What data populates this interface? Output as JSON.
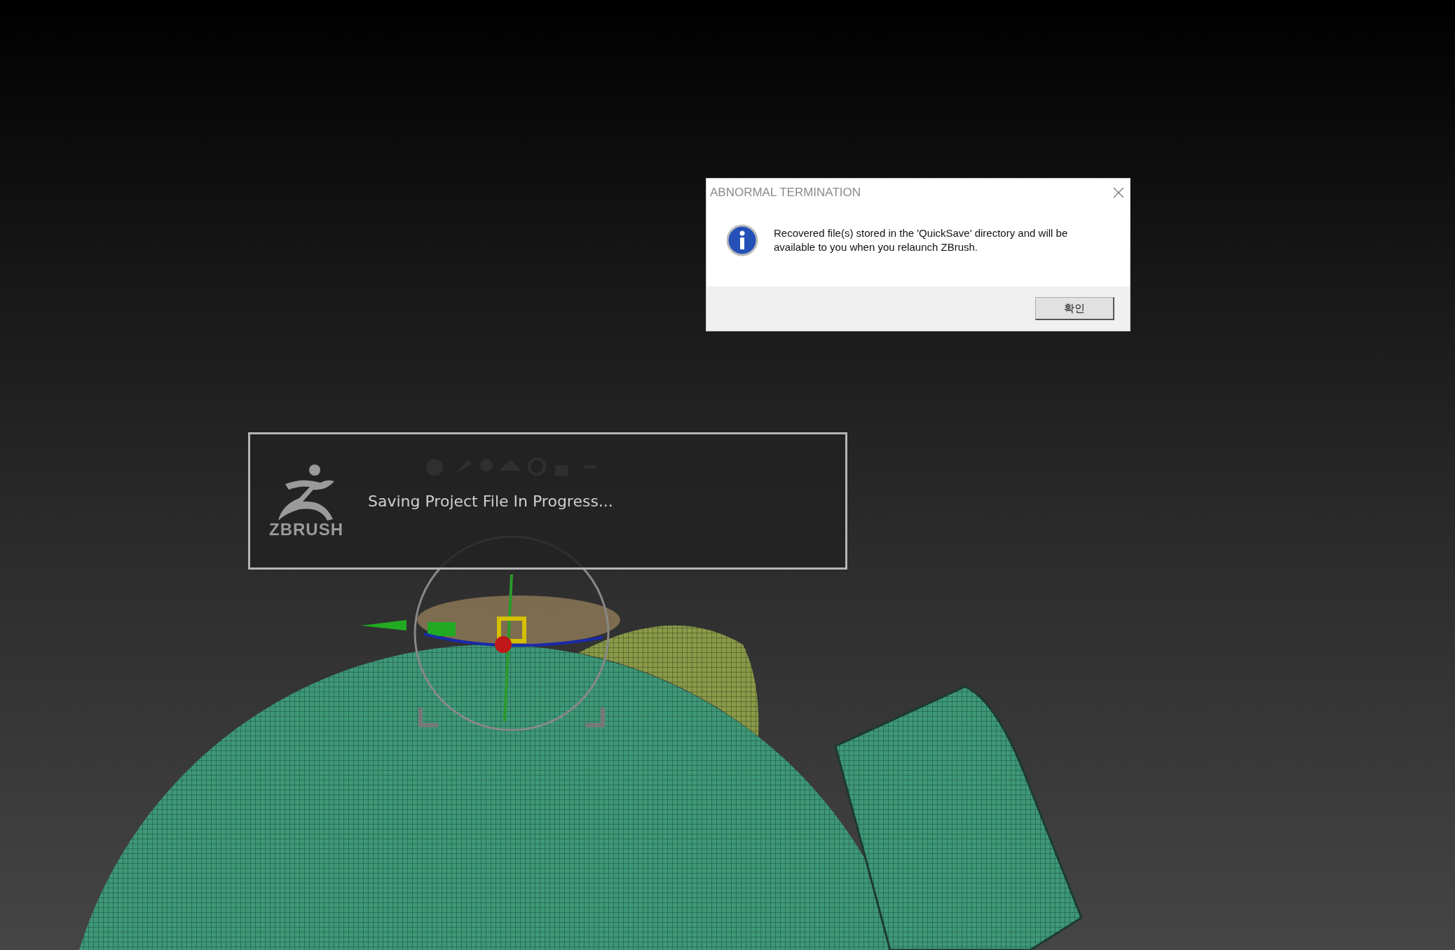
{
  "dialog": {
    "title": "ABNORMAL TERMINATION",
    "message": "Recovered file(s) stored in the 'QuickSave' directory and will be available to you when you relaunch ZBrush.",
    "button": "확인"
  },
  "progress": {
    "logo": "ZBRUSH",
    "message": "Saving Project File In Progress..."
  }
}
